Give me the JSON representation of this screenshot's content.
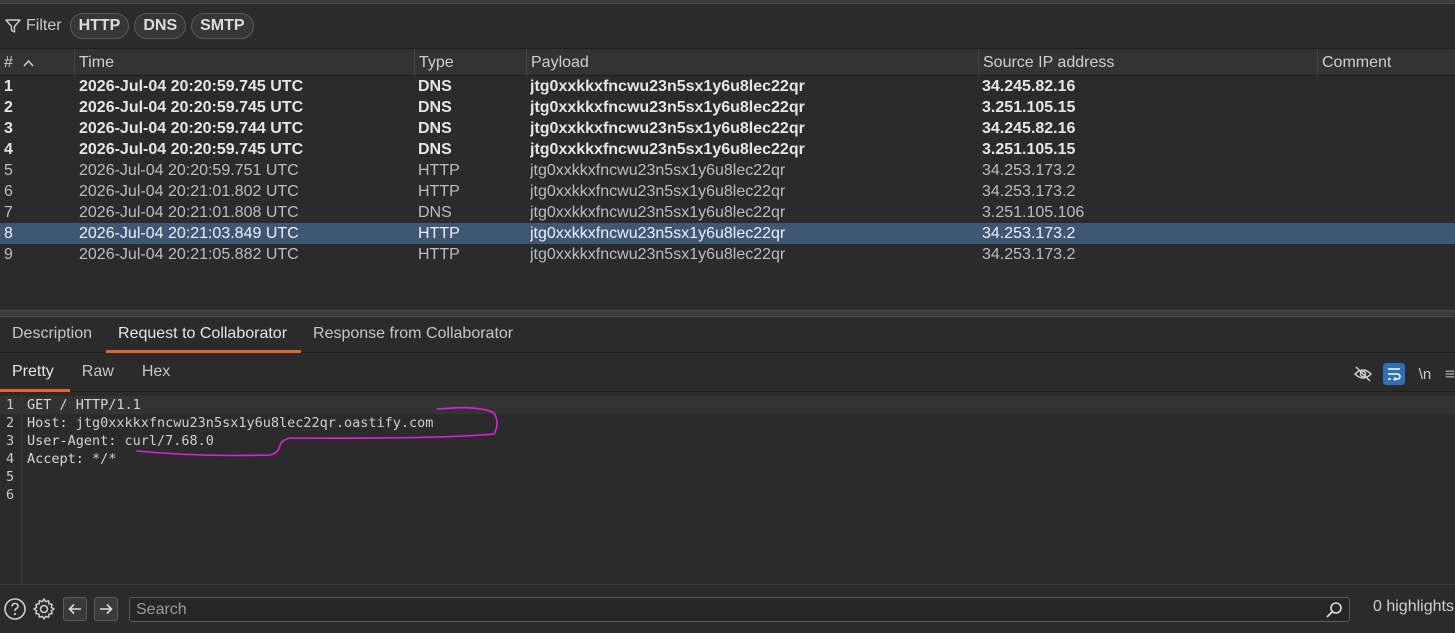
{
  "filter": {
    "label": "Filter",
    "chips": [
      "HTTP",
      "DNS",
      "SMTP"
    ]
  },
  "table": {
    "columns": [
      "#",
      "Time",
      "Type",
      "Payload",
      "Source IP address",
      "Comment"
    ],
    "sort_icon": "chevron-up-icon",
    "rows": [
      {
        "n": "1",
        "time": "2026-Jul-04 20:20:59.745 UTC",
        "type": "DNS",
        "payload": "jtg0xxkkxfncwu23n5sx1y6u8lec22qr",
        "ip": "34.245.82.16",
        "comment": "",
        "style": "bold"
      },
      {
        "n": "2",
        "time": "2026-Jul-04 20:20:59.745 UTC",
        "type": "DNS",
        "payload": "jtg0xxkkxfncwu23n5sx1y6u8lec22qr",
        "ip": "3.251.105.15",
        "comment": "",
        "style": "bold"
      },
      {
        "n": "3",
        "time": "2026-Jul-04 20:20:59.744 UTC",
        "type": "DNS",
        "payload": "jtg0xxkkxfncwu23n5sx1y6u8lec22qr",
        "ip": "34.245.82.16",
        "comment": "",
        "style": "bold"
      },
      {
        "n": "4",
        "time": "2026-Jul-04 20:20:59.745 UTC",
        "type": "DNS",
        "payload": "jtg0xxkkxfncwu23n5sx1y6u8lec22qr",
        "ip": "3.251.105.15",
        "comment": "",
        "style": "bold"
      },
      {
        "n": "5",
        "time": "2026-Jul-04 20:20:59.751 UTC",
        "type": "HTTP",
        "payload": "jtg0xxkkxfncwu23n5sx1y6u8lec22qr",
        "ip": "34.253.173.2",
        "comment": "",
        "style": "normal"
      },
      {
        "n": "6",
        "time": "2026-Jul-04 20:21:01.802 UTC",
        "type": "HTTP",
        "payload": "jtg0xxkkxfncwu23n5sx1y6u8lec22qr",
        "ip": "34.253.173.2",
        "comment": "",
        "style": "normal"
      },
      {
        "n": "7",
        "time": "2026-Jul-04 20:21:01.808 UTC",
        "type": "DNS",
        "payload": "jtg0xxkkxfncwu23n5sx1y6u8lec22qr",
        "ip": "3.251.105.106",
        "comment": "",
        "style": "normal"
      },
      {
        "n": "8",
        "time": "2026-Jul-04 20:21:03.849 UTC",
        "type": "HTTP",
        "payload": "jtg0xxkkxfncwu23n5sx1y6u8lec22qr",
        "ip": "34.253.173.2",
        "comment": "",
        "style": "selected"
      },
      {
        "n": "9",
        "time": "2026-Jul-04 20:21:05.882 UTC",
        "type": "HTTP",
        "payload": "jtg0xxkkxfncwu23n5sx1y6u8lec22qr",
        "ip": "34.253.173.2",
        "comment": "",
        "style": "normal"
      }
    ]
  },
  "detail_tabs": {
    "items": [
      "Description",
      "Request to Collaborator",
      "Response from Collaborator"
    ],
    "active": 1
  },
  "view_tabs": {
    "items": [
      "Pretty",
      "Raw",
      "Hex"
    ],
    "active": 0
  },
  "editor_tools": {
    "hide_icon": "eye-off-icon",
    "wrap_icon": "word-wrap-icon",
    "newline_label": "\\n",
    "menu_icon": "menu-icon"
  },
  "request": {
    "lines": [
      {
        "num": "1",
        "name": "GET / HTTP/1.1",
        "value": ""
      },
      {
        "num": "2",
        "name": "Host:",
        "value": " jtg0xxkkxfncwu23n5sx1y6u8lec22qr.oastify.com"
      },
      {
        "num": "3",
        "name": "User-Agent:",
        "value": " curl/7.68.0"
      },
      {
        "num": "4",
        "name": "Accept:",
        "value": " */*"
      },
      {
        "num": "5",
        "name": "",
        "value": ""
      },
      {
        "num": "6",
        "name": "",
        "value": ""
      }
    ]
  },
  "annotation_color": "#e020e0",
  "footer": {
    "help_icon": "help-icon",
    "settings_icon": "gear-icon",
    "back_icon": "arrow-left-icon",
    "forward_icon": "arrow-right-icon",
    "search_placeholder": "Search",
    "highlights_text": "0 highlights"
  },
  "colors": {
    "accent": "#e2662e",
    "selected_row": "#3d5774",
    "active_tool": "#2f6fb3"
  }
}
